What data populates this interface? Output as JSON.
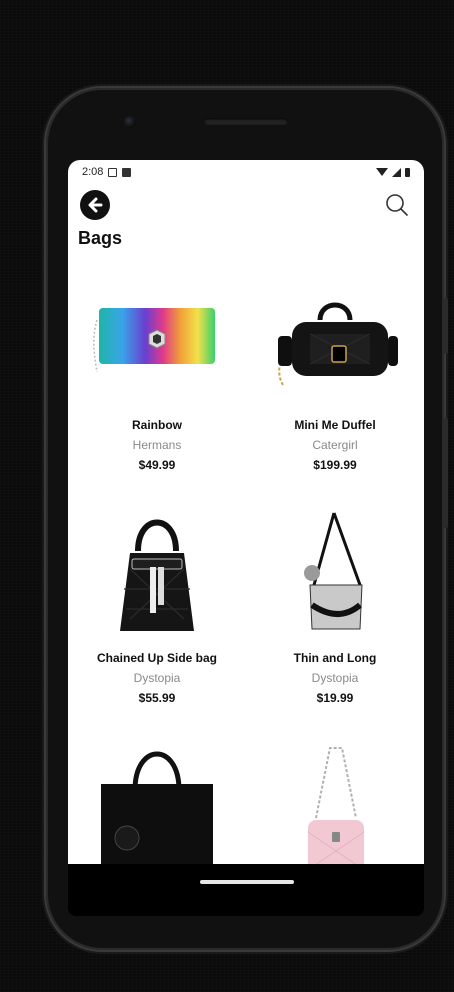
{
  "status_bar": {
    "time": "2:08"
  },
  "app_bar": {
    "title": "Bags"
  },
  "products": [
    {
      "name": "Rainbow",
      "brand": "Hermans",
      "price": "$49.99"
    },
    {
      "name": "Mini Me Duffel",
      "brand": "Catergirl",
      "price": "$199.99"
    },
    {
      "name": "Chained Up Side bag",
      "brand": "Dystopia",
      "price": "$55.99"
    },
    {
      "name": "Thin and Long",
      "brand": "Dystopia",
      "price": "$19.99"
    },
    {
      "name": "",
      "brand": "",
      "price": ""
    },
    {
      "name": "",
      "brand": "",
      "price": ""
    }
  ],
  "icons": {
    "back": "arrow-left-circle-icon",
    "search": "search-icon"
  },
  "colors": {
    "background": "#0b0b0b",
    "screen": "#ffffff",
    "text_primary": "#111111",
    "text_secondary": "#8a8a8a"
  }
}
